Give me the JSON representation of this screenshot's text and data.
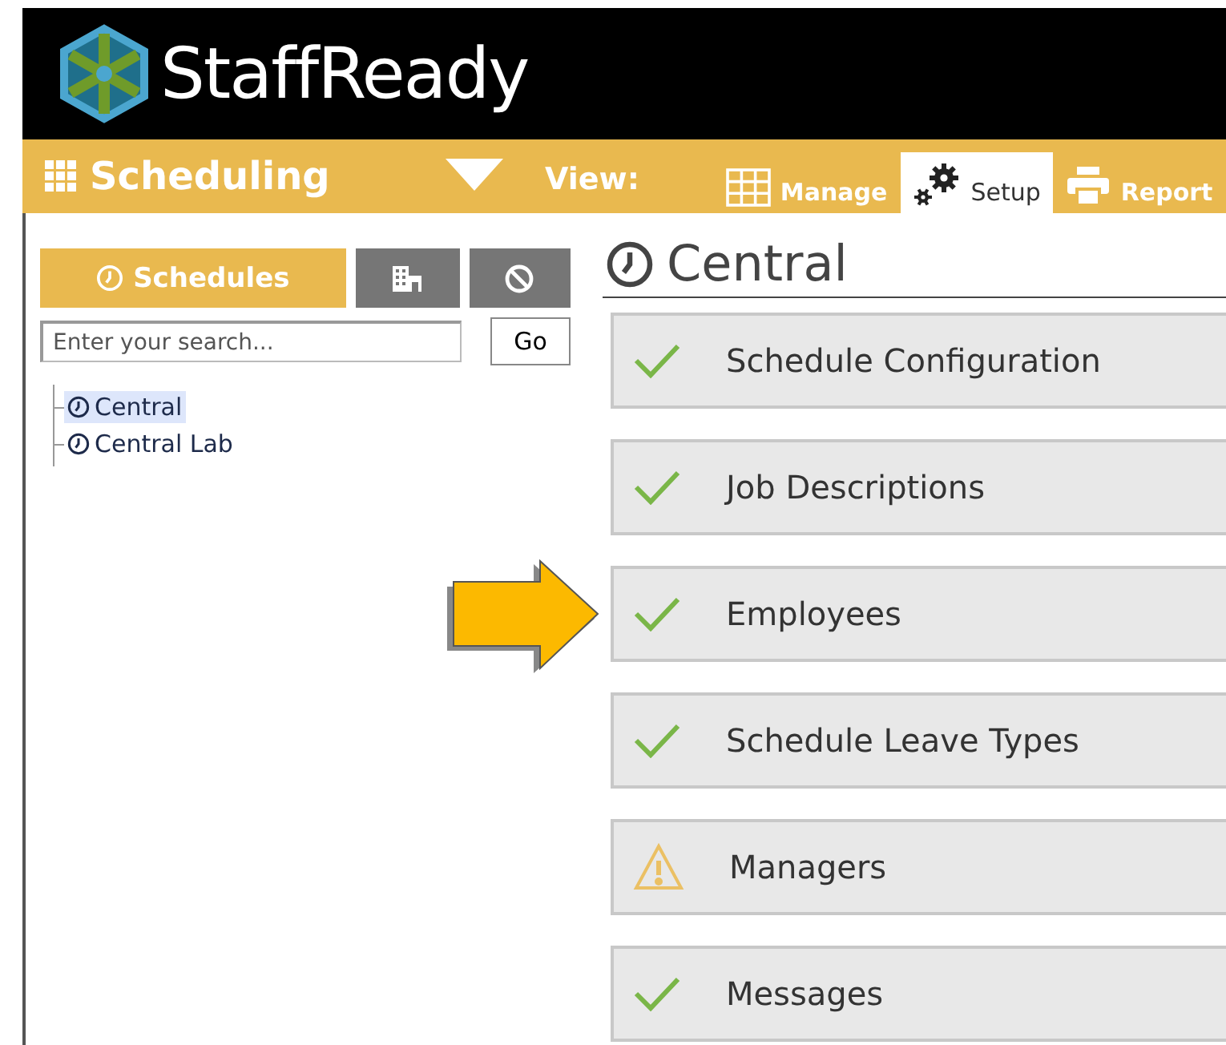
{
  "brand": {
    "name": "StaffReady"
  },
  "nav": {
    "module": "Scheduling",
    "view_label": "View:",
    "tabs": [
      {
        "label": "Manage",
        "kind": "grid",
        "selected": false
      },
      {
        "label": "Setup",
        "kind": "gears",
        "selected": true
      },
      {
        "label": "Report",
        "kind": "printer",
        "selected": false
      }
    ]
  },
  "sidebar": {
    "tabs": [
      {
        "label": "Schedules",
        "kind": "clock",
        "selected": true
      },
      {
        "kind": "building",
        "selected": false
      },
      {
        "kind": "ban",
        "selected": false
      }
    ],
    "search": {
      "placeholder": "Enter your search...",
      "button": "Go"
    },
    "tree": [
      {
        "label": "Central",
        "selected": true
      },
      {
        "label": "Central Lab",
        "selected": false
      }
    ]
  },
  "main": {
    "title": "Central",
    "steps": [
      {
        "label": "Schedule Configuration",
        "kind": "done"
      },
      {
        "label": "Job Descriptions",
        "kind": "done"
      },
      {
        "label": "Employees",
        "kind": "done",
        "pointed": true
      },
      {
        "label": "Schedule Leave Types",
        "kind": "done"
      },
      {
        "label": "Managers",
        "kind": "warning"
      },
      {
        "label": "Messages",
        "kind": "done"
      }
    ]
  }
}
